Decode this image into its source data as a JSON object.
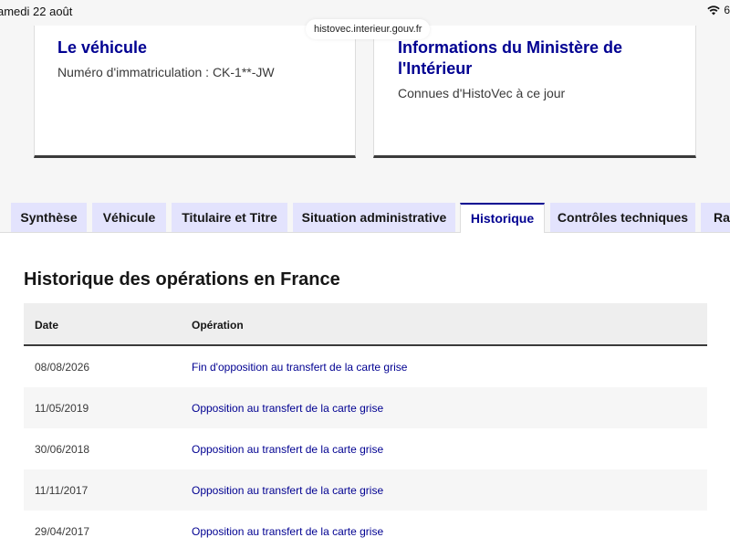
{
  "status_bar": {
    "time": "amedi 22 août",
    "url": "histovec.interieur.gouv.fr",
    "battery": "6"
  },
  "cards": {
    "vehicle": {
      "title": "Le véhicule",
      "desc": "Numéro d'immatriculation : CK-1**-JW"
    },
    "ministry": {
      "title": "Informations du Ministère de l'Intérieur",
      "desc": "Connues d'HistoVec à ce jour"
    }
  },
  "tabs": [
    {
      "label": "Synthèse"
    },
    {
      "label": "Véhicule"
    },
    {
      "label": "Titulaire et Titre"
    },
    {
      "label": "Situation administrative"
    },
    {
      "label": "Historique"
    },
    {
      "label": "Contrôles techniques"
    },
    {
      "label": "Ra"
    }
  ],
  "active_tab": "Historique",
  "history": {
    "title": "Historique des opérations en France",
    "columns": {
      "date": "Date",
      "operation": "Opération"
    },
    "rows": [
      {
        "date": "08/08/2026",
        "operation": "Fin d'opposition au transfert de la carte grise"
      },
      {
        "date": "11/05/2019",
        "operation": "Opposition au transfert de la carte grise"
      },
      {
        "date": "30/06/2018",
        "operation": "Opposition au transfert de la carte grise"
      },
      {
        "date": "11/11/2017",
        "operation": "Opposition au transfert de la carte grise"
      },
      {
        "date": "29/04/2017",
        "operation": "Opposition au transfert de la carte grise"
      }
    ]
  },
  "colors": {
    "primary": "#000091",
    "tab_bg": "#e3e3fd",
    "row_alt": "#f6f6f6"
  }
}
